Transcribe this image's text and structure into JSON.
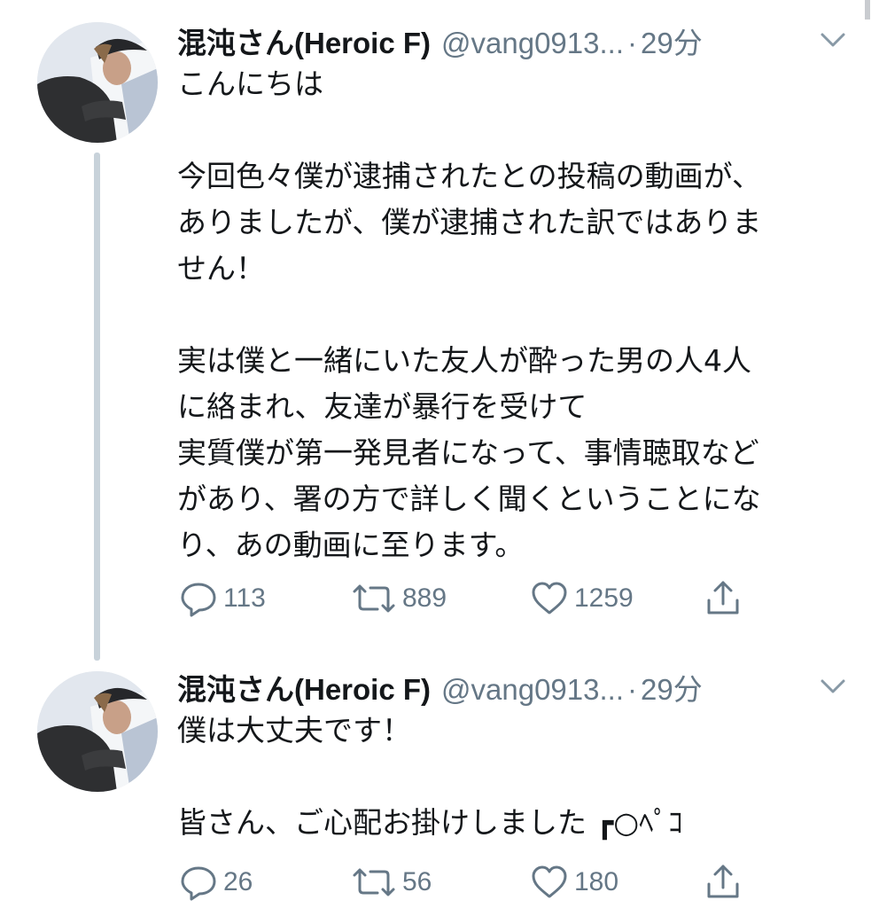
{
  "tweets": [
    {
      "display_name": "混沌さん(Heroic F)",
      "handle": "@vang0913...",
      "separator": "·",
      "timestamp": "29分",
      "text": "こんにちは\n\n今回色々僕が逮捕されたとの投稿の動画が、\nありましたが、僕が逮捕された訳ではありま\nせん！\n\n実は僕と一緒にいた友人が酔った男の人4人\nに絡まれ、友達が暴行を受けて\n実質僕が第一発見者になって、事情聴取など\nがあり、署の方で詳しく聞くということにな\nり、あの動画に至ります。",
      "replies": "113",
      "retweets": "889",
      "likes": "1259"
    },
    {
      "display_name": "混沌さん(Heroic F)",
      "handle": "@vang0913...",
      "separator": "·",
      "timestamp": "29分",
      "text": "僕は大丈夫です！\n\n皆さん、ご心配お掛けしました ┏○ﾍﾟｺ",
      "replies": "26",
      "retweets": "56",
      "likes": "180"
    }
  ],
  "icons": {
    "caret": "chevron-down-icon",
    "reply": "reply-icon",
    "retweet": "retweet-icon",
    "like": "heart-icon",
    "share": "share-icon"
  },
  "colors": {
    "text": "#14171a",
    "secondary": "#657786",
    "thread_line": "#c8d2da"
  }
}
